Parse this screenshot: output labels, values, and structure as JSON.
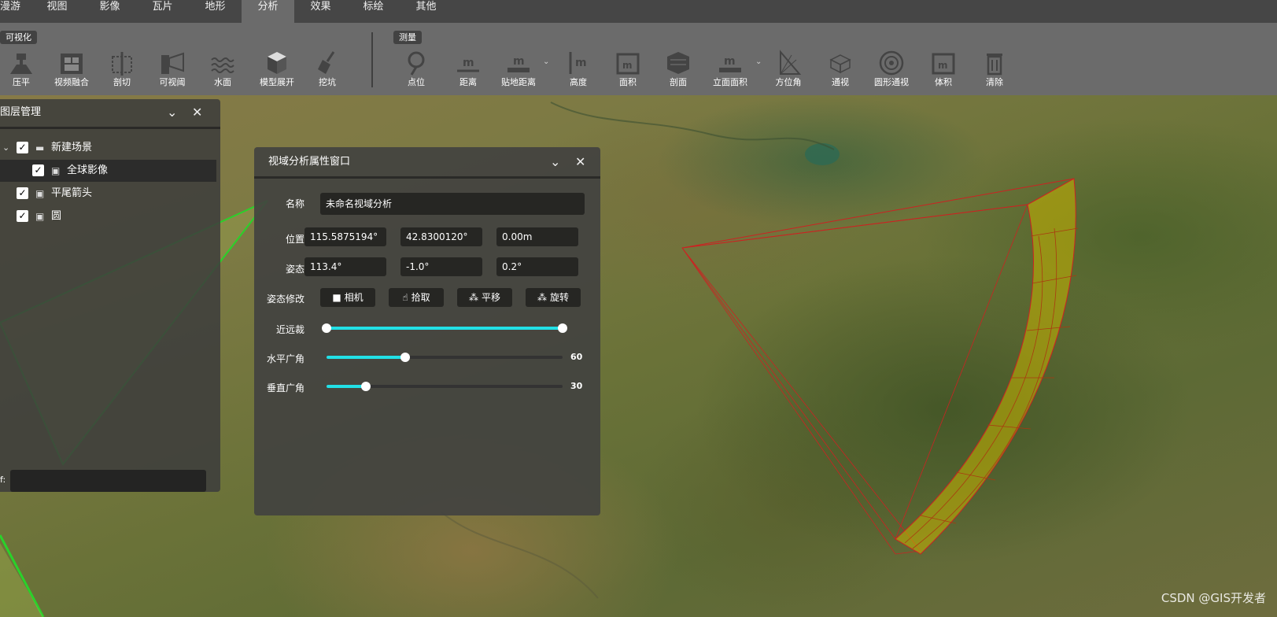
{
  "menu": {
    "tabs": [
      "漫游",
      "视图",
      "影像",
      "瓦片",
      "地形",
      "分析",
      "效果",
      "标绘",
      "其他"
    ],
    "active": "分析"
  },
  "toolbar": {
    "visual_group": "可视化",
    "measure_group": "测量",
    "visual_tools": [
      "压平",
      "视频融合",
      "剖切",
      "可视阈",
      "水面",
      "模型展开",
      "挖坑"
    ],
    "measure_tools": [
      "点位",
      "距离",
      "贴地距离",
      "高度",
      "面积",
      "剖面",
      "立面面积",
      "方位角",
      "通视",
      "圆形通视",
      "体积",
      "清除"
    ]
  },
  "layer_panel": {
    "title": "图层管理",
    "items": [
      {
        "label": "新建场景",
        "checked": true,
        "icon": "folder-icon"
      },
      {
        "label": "全球影像",
        "checked": true,
        "icon": "image-icon"
      },
      {
        "label": "平尾箭头",
        "checked": true,
        "icon": "image-icon"
      },
      {
        "label": "圆",
        "checked": true,
        "icon": "image-icon"
      }
    ],
    "footer_label": "f:"
  },
  "viewshed_panel": {
    "title": "视域分析属性窗口",
    "name_label": "名称",
    "name_value": "未命名视域分析",
    "position_label": "位置",
    "position": [
      "115.5875194°",
      "42.8300120°",
      "0.00m"
    ],
    "attitude_label": "姿态",
    "attitude": [
      "113.4°",
      "-1.0°",
      "0.2°"
    ],
    "modify_label": "姿态修改",
    "buttons": [
      "相机",
      "拾取",
      "平移",
      "旋转"
    ],
    "near_far_label": "近远裁",
    "near_far": [
      0,
      1
    ],
    "h_fov_label": "水平广角",
    "h_fov": 60,
    "h_fov_max": 180,
    "v_fov_label": "垂直广角",
    "v_fov": 30,
    "v_fov_max": 180
  },
  "watermark": "CSDN @GIS开发者",
  "colors": {
    "accent": "#22e0e6",
    "menu_bg": "#464646",
    "toolbar_bg": "#6b6b6b",
    "frustum": "#cc2222",
    "viewshed_fill": "#c8b400"
  }
}
